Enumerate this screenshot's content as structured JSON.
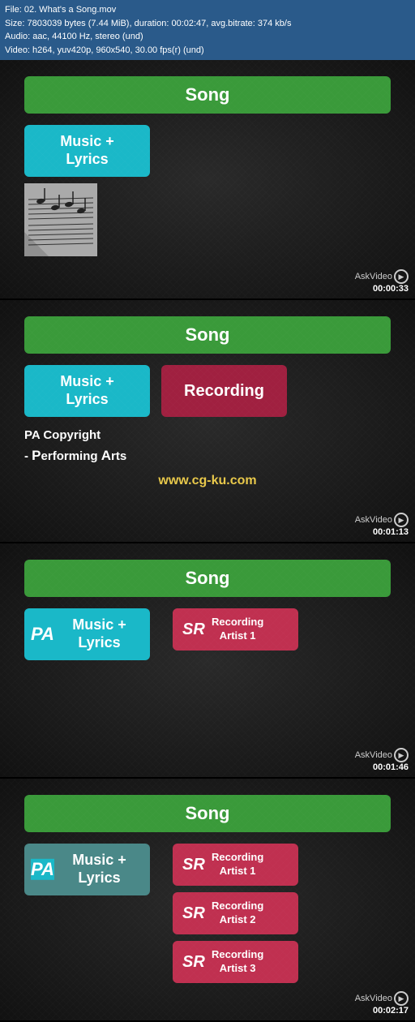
{
  "infobar": {
    "line1": "File: 02. What's a Song.mov",
    "line2": "Size: 7803039 bytes (7.44 MiB), duration: 00:02:47, avg.bitrate: 374 kb/s",
    "line3": "Audio: aac, 44100 Hz, stereo (und)",
    "line4": "Video: h264, yuv420p, 960x540, 30.00 fps(r) (und)"
  },
  "panels": [
    {
      "id": "panel1",
      "song_label": "Song",
      "music_lyrics_label": "Music +\nLyrics",
      "timestamp": "00:00:33",
      "has_sheet": true
    },
    {
      "id": "panel2",
      "song_label": "Song",
      "music_lyrics_label": "Music +\nLyrics",
      "recording_label": "Recording",
      "pa_copyright_line1": "PA Copyright",
      "pa_copyright_line2": "- Performing Arts",
      "watermark": "www.cg-ku.com",
      "timestamp": "00:01:13"
    },
    {
      "id": "panel3",
      "song_label": "Song",
      "music_lyrics_label": "Music +\nLyrics",
      "pa_label": "PA",
      "sr_label": "SR",
      "recording_artist_label": "Recording\nArtist 1",
      "timestamp": "00:01:46"
    },
    {
      "id": "panel4",
      "song_label": "Song",
      "music_lyrics_label": "Music +\nLyrics",
      "pa_label": "PA",
      "sr_label": "SR",
      "recordings": [
        {
          "sr": "SR",
          "label": "Recording\nArtist 1"
        },
        {
          "sr": "SR",
          "label": "Recording\nArtist 2"
        },
        {
          "sr": "SR",
          "label": "Recording\nArtist 3"
        }
      ],
      "timestamp": "00:02:17"
    }
  ],
  "askvideo": "AskVideo"
}
